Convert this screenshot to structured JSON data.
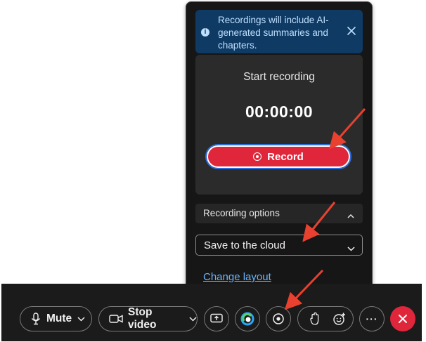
{
  "banner": {
    "text": "Recordings will include AI-generated summaries and chapters.",
    "info_icon": "i"
  },
  "recording": {
    "title": "Start recording",
    "timer": "00:00:00",
    "record_label": "Record"
  },
  "options": {
    "label": "Recording options",
    "save_value": "Save to the cloud",
    "change_layout": "Change layout"
  },
  "toolbar": {
    "mute_label": "Mute",
    "video_label": "Stop video",
    "more_label": "···"
  },
  "colors": {
    "record": "#e0263a",
    "banner": "#0e3a64",
    "link": "#6cb4ff",
    "annotation_arrow": "#e8412f"
  }
}
